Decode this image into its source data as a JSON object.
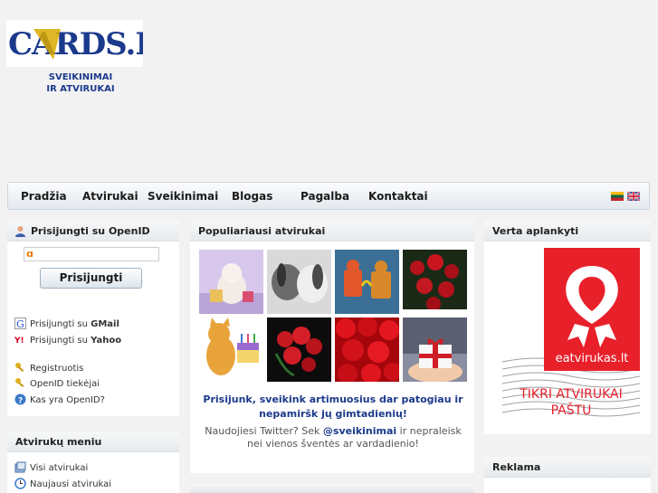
{
  "site": {
    "logo_text": "CARDS.LT",
    "tagline_line1": "SVEIKINIMAI",
    "tagline_line2": "IR ATVIRUKAI"
  },
  "nav": {
    "items": [
      "Pradžia",
      "Atvirukai",
      "Sveikinimai",
      "Blogas",
      "Pagalba",
      "Kontaktai"
    ]
  },
  "openid_box": {
    "title": "Prisijungti su OpenID",
    "input_value": "",
    "login_button": "Prisijungti",
    "gmail_prefix": "Prisijungti su ",
    "gmail_name": "GMail",
    "yahoo_prefix": "Prisijungti su ",
    "yahoo_name": "Yahoo",
    "register": "Registruotis",
    "providers": "OpenID tiekėjai",
    "what_is": "Kas yra OpenID?"
  },
  "cards_menu": {
    "title": "Atvirukų meniu",
    "items": [
      "Visi atvirukai",
      "Naujausi atvirukai"
    ]
  },
  "popular": {
    "title": "Populiariausi atvirukai",
    "thumbs": [
      "kitten-with-gifts",
      "dogs-kissing",
      "cartoon-lovers",
      "red-roses",
      "cartoon-cat-birthday-cake",
      "rose-bouquet",
      "red-roses-closeup",
      "gift-box-in-hands"
    ],
    "promo": "Prisijunk, sveikink artimuosius dar patogiau ir nepamiršk jų gimtadienių!",
    "twitter_prefix": "Naudojiesi Twitter? Sek ",
    "twitter_handle": "@sveikinimai",
    "twitter_suffix": " ir nepraleisk nei vienos šventės ar vardadienio!"
  },
  "right": {
    "visit_title": "Verta aplankyti",
    "banner_site": "eatvirukas.lt",
    "banner_line1": "TIKRI ATVIRUKAI",
    "banner_line2": "PAŠTU",
    "ads_title": "Reklama"
  },
  "colors": {
    "accent_blue": "#1c3a8c",
    "banner_red": "#e8202a"
  }
}
